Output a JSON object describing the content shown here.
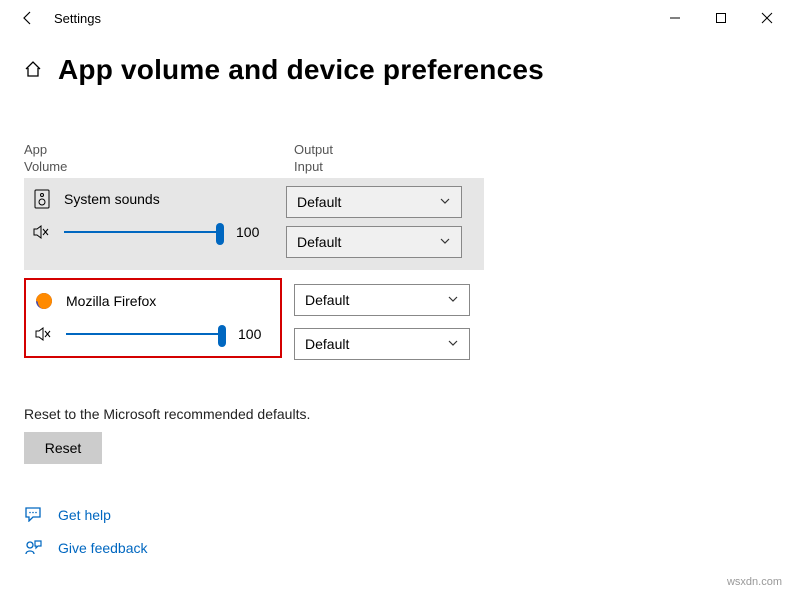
{
  "window": {
    "title": "Settings"
  },
  "page": {
    "title": "App volume and device preferences"
  },
  "columns": {
    "app_l1": "App",
    "app_l2": "Volume",
    "out_l1": "Output",
    "out_l2": "Input"
  },
  "apps": {
    "system": {
      "name": "System sounds",
      "volume": "100",
      "output": "Default",
      "input": "Default"
    },
    "firefox": {
      "name": "Mozilla Firefox",
      "volume": "100",
      "output": "Default",
      "input": "Default"
    }
  },
  "reset": {
    "label": "Reset to the Microsoft recommended defaults.",
    "button": "Reset"
  },
  "links": {
    "help": "Get help",
    "feedback": "Give feedback"
  },
  "watermark": "wsxdn.com"
}
